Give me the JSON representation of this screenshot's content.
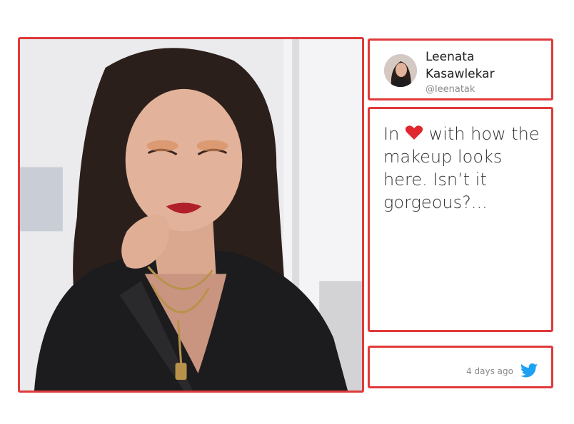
{
  "author": {
    "name": "Leenata Kasawlekar",
    "handle": "@leenatak"
  },
  "tweet": {
    "text_before": "In",
    "text_after": " with how the makeup looks here. Isn’t it gorgeous?...",
    "inline_icon": "heart-icon",
    "heart_color": "#e0262e"
  },
  "footer": {
    "time_ago": "4 days ago",
    "source_icon": "twitter-icon",
    "twitter_color": "#1da1f2"
  },
  "colors": {
    "highlight_border": "#e03a3a"
  }
}
